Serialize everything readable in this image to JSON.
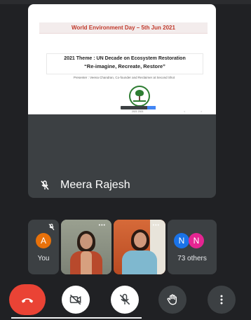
{
  "slide": {
    "banner": "World Environment Day – 5th Jun 2021",
    "theme": "2021 Theme : UN Decade on Ecosystem Restoration",
    "quote": "“Re-imagine, Recreate, Restore”",
    "presenter": "Presenter : Veena Chandran, Co-founder and Reclaimer at Second Shot",
    "date": "2021 2021"
  },
  "main_tile": {
    "presenter_name": "Meera Rajesh",
    "mic_state": "muted"
  },
  "participants": {
    "you": {
      "initial": "A",
      "label": "You",
      "color": "#e8710a"
    },
    "others": {
      "avatars": [
        {
          "initial": "N",
          "color": "#1a73e8"
        },
        {
          "initial": "N",
          "color": "#e52592"
        }
      ],
      "label": "73 others"
    }
  },
  "controls": {
    "end_call": "phone-hangup-icon",
    "camera": "camera-off-icon",
    "mic": "mic-off-icon",
    "raise_hand": "hand-icon",
    "more": "more-vertical-icon"
  },
  "colors": {
    "background": "#202124",
    "tile": "#3c4043",
    "end_call": "#ea4335",
    "slide_banner_text": "#c0392b",
    "logo_green": "#2e7d32"
  }
}
